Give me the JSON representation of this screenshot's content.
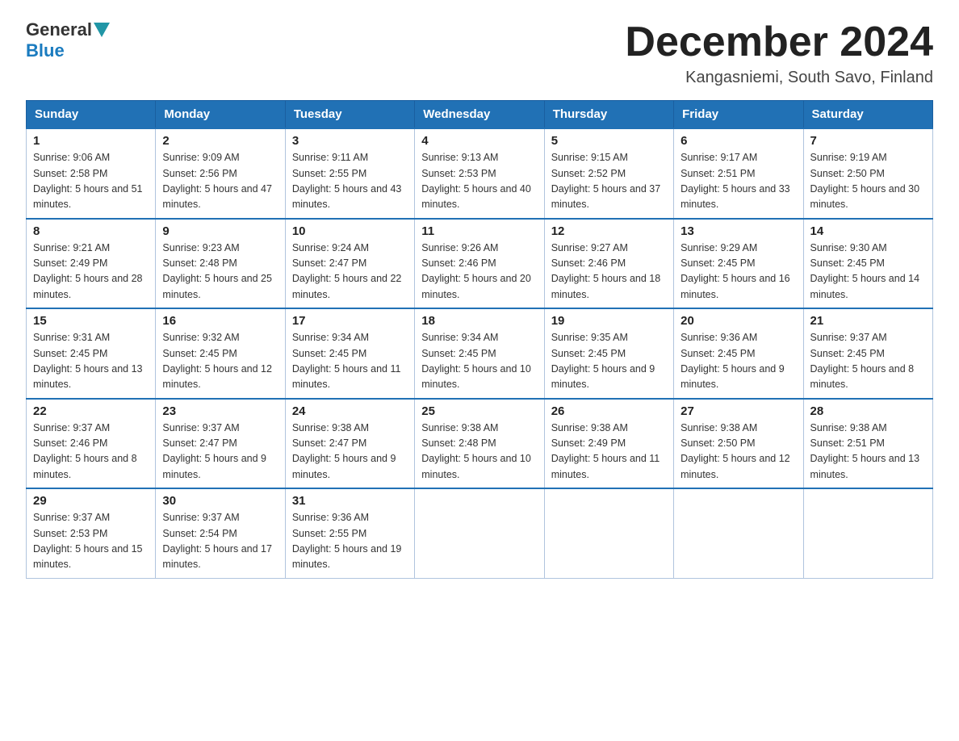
{
  "header": {
    "logo_general": "General",
    "logo_blue": "Blue",
    "month_title": "December 2024",
    "subtitle": "Kangasniemi, South Savo, Finland"
  },
  "days_of_week": [
    "Sunday",
    "Monday",
    "Tuesday",
    "Wednesday",
    "Thursday",
    "Friday",
    "Saturday"
  ],
  "weeks": [
    [
      {
        "day": "1",
        "sunrise": "9:06 AM",
        "sunset": "2:58 PM",
        "daylight": "5 hours and 51 minutes."
      },
      {
        "day": "2",
        "sunrise": "9:09 AM",
        "sunset": "2:56 PM",
        "daylight": "5 hours and 47 minutes."
      },
      {
        "day": "3",
        "sunrise": "9:11 AM",
        "sunset": "2:55 PM",
        "daylight": "5 hours and 43 minutes."
      },
      {
        "day": "4",
        "sunrise": "9:13 AM",
        "sunset": "2:53 PM",
        "daylight": "5 hours and 40 minutes."
      },
      {
        "day": "5",
        "sunrise": "9:15 AM",
        "sunset": "2:52 PM",
        "daylight": "5 hours and 37 minutes."
      },
      {
        "day": "6",
        "sunrise": "9:17 AM",
        "sunset": "2:51 PM",
        "daylight": "5 hours and 33 minutes."
      },
      {
        "day": "7",
        "sunrise": "9:19 AM",
        "sunset": "2:50 PM",
        "daylight": "5 hours and 30 minutes."
      }
    ],
    [
      {
        "day": "8",
        "sunrise": "9:21 AM",
        "sunset": "2:49 PM",
        "daylight": "5 hours and 28 minutes."
      },
      {
        "day": "9",
        "sunrise": "9:23 AM",
        "sunset": "2:48 PM",
        "daylight": "5 hours and 25 minutes."
      },
      {
        "day": "10",
        "sunrise": "9:24 AM",
        "sunset": "2:47 PM",
        "daylight": "5 hours and 22 minutes."
      },
      {
        "day": "11",
        "sunrise": "9:26 AM",
        "sunset": "2:46 PM",
        "daylight": "5 hours and 20 minutes."
      },
      {
        "day": "12",
        "sunrise": "9:27 AM",
        "sunset": "2:46 PM",
        "daylight": "5 hours and 18 minutes."
      },
      {
        "day": "13",
        "sunrise": "9:29 AM",
        "sunset": "2:45 PM",
        "daylight": "5 hours and 16 minutes."
      },
      {
        "day": "14",
        "sunrise": "9:30 AM",
        "sunset": "2:45 PM",
        "daylight": "5 hours and 14 minutes."
      }
    ],
    [
      {
        "day": "15",
        "sunrise": "9:31 AM",
        "sunset": "2:45 PM",
        "daylight": "5 hours and 13 minutes."
      },
      {
        "day": "16",
        "sunrise": "9:32 AM",
        "sunset": "2:45 PM",
        "daylight": "5 hours and 12 minutes."
      },
      {
        "day": "17",
        "sunrise": "9:34 AM",
        "sunset": "2:45 PM",
        "daylight": "5 hours and 11 minutes."
      },
      {
        "day": "18",
        "sunrise": "9:34 AM",
        "sunset": "2:45 PM",
        "daylight": "5 hours and 10 minutes."
      },
      {
        "day": "19",
        "sunrise": "9:35 AM",
        "sunset": "2:45 PM",
        "daylight": "5 hours and 9 minutes."
      },
      {
        "day": "20",
        "sunrise": "9:36 AM",
        "sunset": "2:45 PM",
        "daylight": "5 hours and 9 minutes."
      },
      {
        "day": "21",
        "sunrise": "9:37 AM",
        "sunset": "2:45 PM",
        "daylight": "5 hours and 8 minutes."
      }
    ],
    [
      {
        "day": "22",
        "sunrise": "9:37 AM",
        "sunset": "2:46 PM",
        "daylight": "5 hours and 8 minutes."
      },
      {
        "day": "23",
        "sunrise": "9:37 AM",
        "sunset": "2:47 PM",
        "daylight": "5 hours and 9 minutes."
      },
      {
        "day": "24",
        "sunrise": "9:38 AM",
        "sunset": "2:47 PM",
        "daylight": "5 hours and 9 minutes."
      },
      {
        "day": "25",
        "sunrise": "9:38 AM",
        "sunset": "2:48 PM",
        "daylight": "5 hours and 10 minutes."
      },
      {
        "day": "26",
        "sunrise": "9:38 AM",
        "sunset": "2:49 PM",
        "daylight": "5 hours and 11 minutes."
      },
      {
        "day": "27",
        "sunrise": "9:38 AM",
        "sunset": "2:50 PM",
        "daylight": "5 hours and 12 minutes."
      },
      {
        "day": "28",
        "sunrise": "9:38 AM",
        "sunset": "2:51 PM",
        "daylight": "5 hours and 13 minutes."
      }
    ],
    [
      {
        "day": "29",
        "sunrise": "9:37 AM",
        "sunset": "2:53 PM",
        "daylight": "5 hours and 15 minutes."
      },
      {
        "day": "30",
        "sunrise": "9:37 AM",
        "sunset": "2:54 PM",
        "daylight": "5 hours and 17 minutes."
      },
      {
        "day": "31",
        "sunrise": "9:36 AM",
        "sunset": "2:55 PM",
        "daylight": "5 hours and 19 minutes."
      },
      null,
      null,
      null,
      null
    ]
  ]
}
